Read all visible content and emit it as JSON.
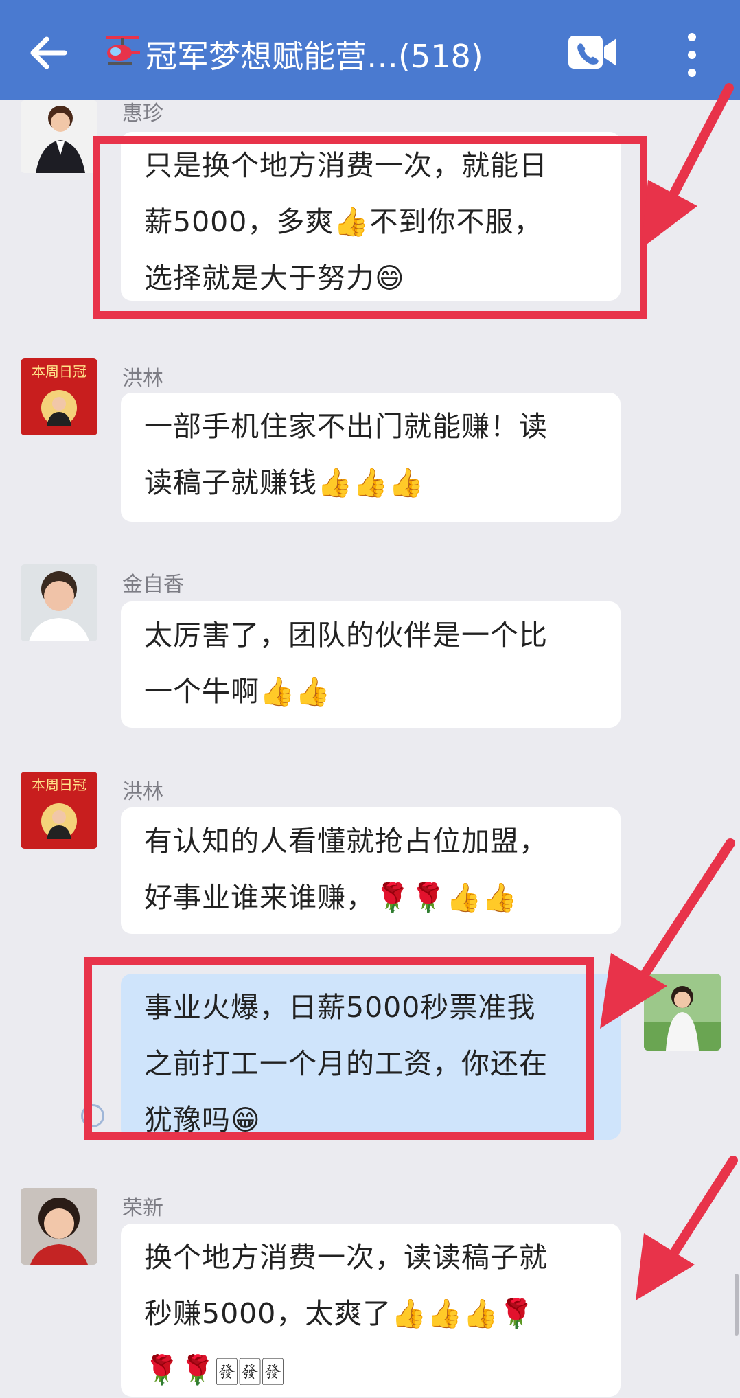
{
  "header": {
    "title": "冠军梦想赋能营…(518)",
    "title_icon": "helicopter-icon"
  },
  "messages": [
    {
      "sender": "惠珍",
      "lines": [
        "只是换个地方消费一次，就能日",
        "薪5000，多爽👍不到你不服，",
        "选择就是大于努力😄"
      ]
    },
    {
      "sender": "洪林",
      "avatar_text": "本周日冠",
      "lines": [
        "一部手机住家不出门就能赚！读",
        "读稿子就赚钱👍👍👍"
      ]
    },
    {
      "sender": "金自香",
      "lines": [
        "太厉害了，团队的伙伴是一个比",
        "一个牛啊👍👍"
      ]
    },
    {
      "sender": "洪林",
      "avatar_text": "本周日冠",
      "lines": [
        "有认知的人看懂就抢占位加盟，",
        "好事业谁来谁赚，🌹🌹👍👍"
      ]
    },
    {
      "sender": "",
      "self": true,
      "lines": [
        "事业火爆，日薪5000秒票准我",
        "之前打工一个月的工资，你还在",
        "犹豫吗😁"
      ]
    },
    {
      "sender": "荣新",
      "lines": [
        "换个地方消费一次，读读稿子就",
        "秒赚5000，太爽了👍👍👍🌹",
        "🌹🌹🀅🀅🀅"
      ]
    }
  ],
  "colors": {
    "header": "#4a7ad0",
    "background": "#ebebf0",
    "annotation_red": "#e8334a",
    "self_bubble": "#cfe4fb"
  },
  "icons": [
    "back-arrow-icon",
    "video-call-icon",
    "more-vertical-icon"
  ]
}
